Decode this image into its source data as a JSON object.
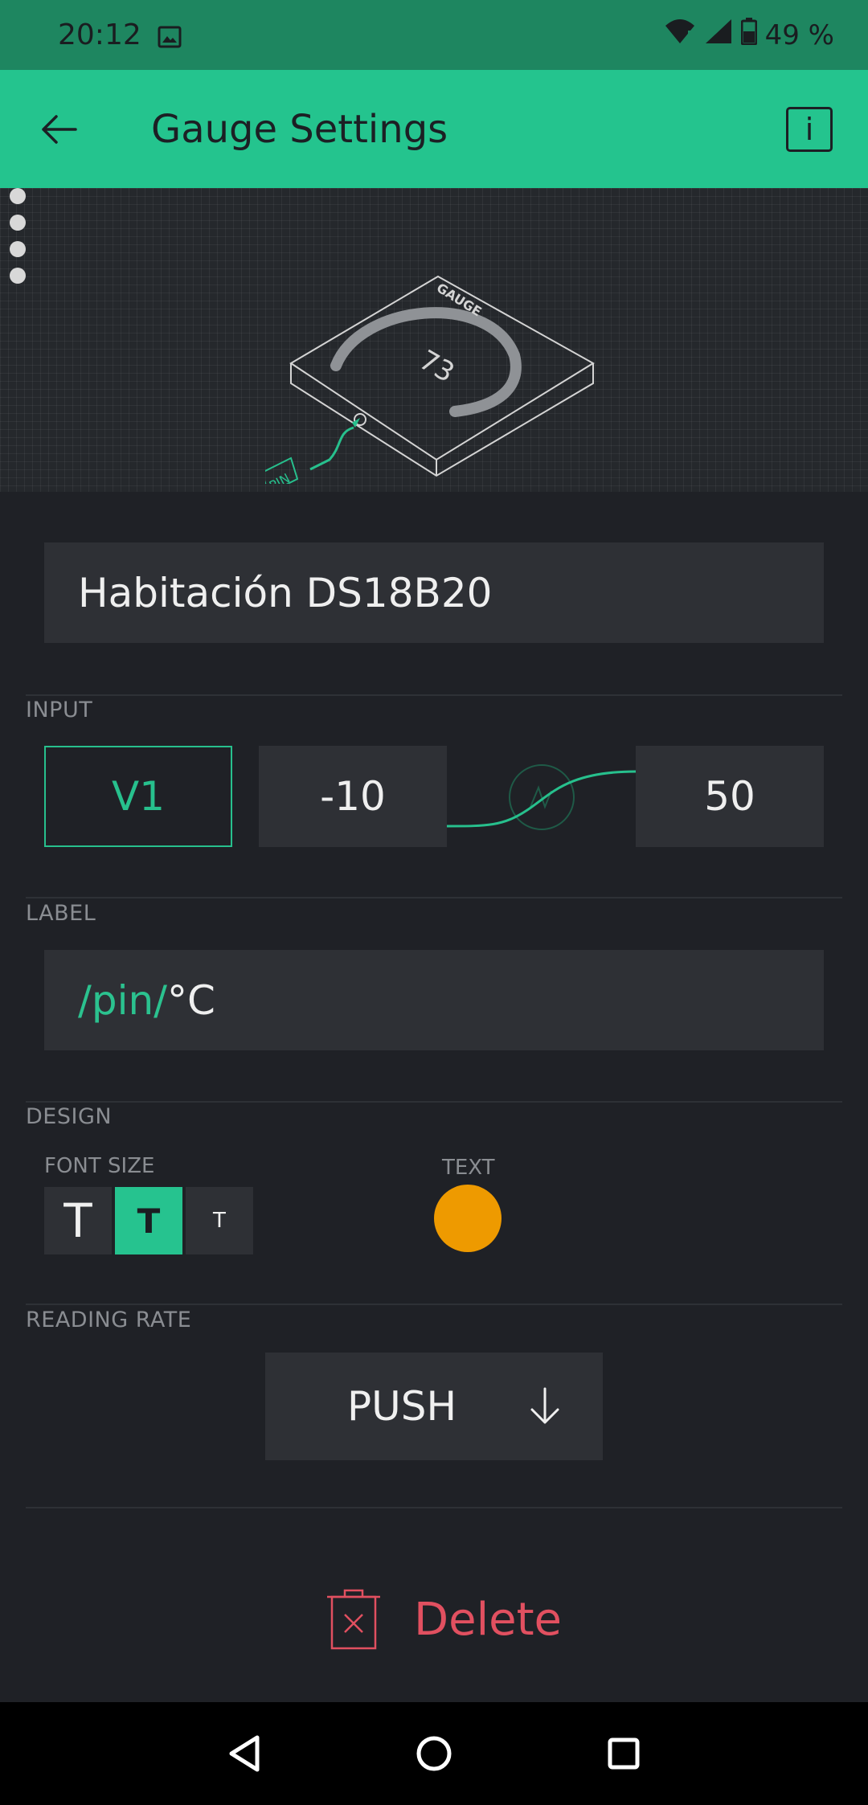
{
  "status_bar": {
    "time": "20:12",
    "battery": "49 %",
    "icons": [
      "gallery-icon",
      "wifi-icon",
      "signal-icon",
      "battery-icon"
    ]
  },
  "app_bar": {
    "title": "Gauge Settings",
    "back_icon": "arrow-left-icon",
    "info_label": "i"
  },
  "preview": {
    "gauge_tag": "GAUGE",
    "gauge_value": "73",
    "pin_tag": "PIN"
  },
  "name_field": {
    "value": "Habitación DS18B20"
  },
  "input": {
    "section_title": "INPUT",
    "pin": "V1",
    "min": "-10",
    "max": "50"
  },
  "label": {
    "section_title": "LABEL",
    "pin_token": "/pin/",
    "suffix": "°C"
  },
  "design": {
    "section_title": "DESIGN",
    "font_size_label": "FONT SIZE",
    "font_options": [
      "T",
      "T",
      "T"
    ],
    "selected_font_index": 1,
    "text_color_label": "TEXT",
    "text_color": "#ee9a00"
  },
  "reading_rate": {
    "section_title": "READING RATE",
    "value": "PUSH"
  },
  "delete": {
    "label": "Delete"
  },
  "nav_bar": {
    "icons": [
      "back-triangle-icon",
      "home-circle-icon",
      "recents-square-icon"
    ]
  },
  "colors": {
    "accent": "#24c48e",
    "status_bar": "#1e8660",
    "background": "#1f2126",
    "field": "#2e3035",
    "danger": "#e15060"
  }
}
